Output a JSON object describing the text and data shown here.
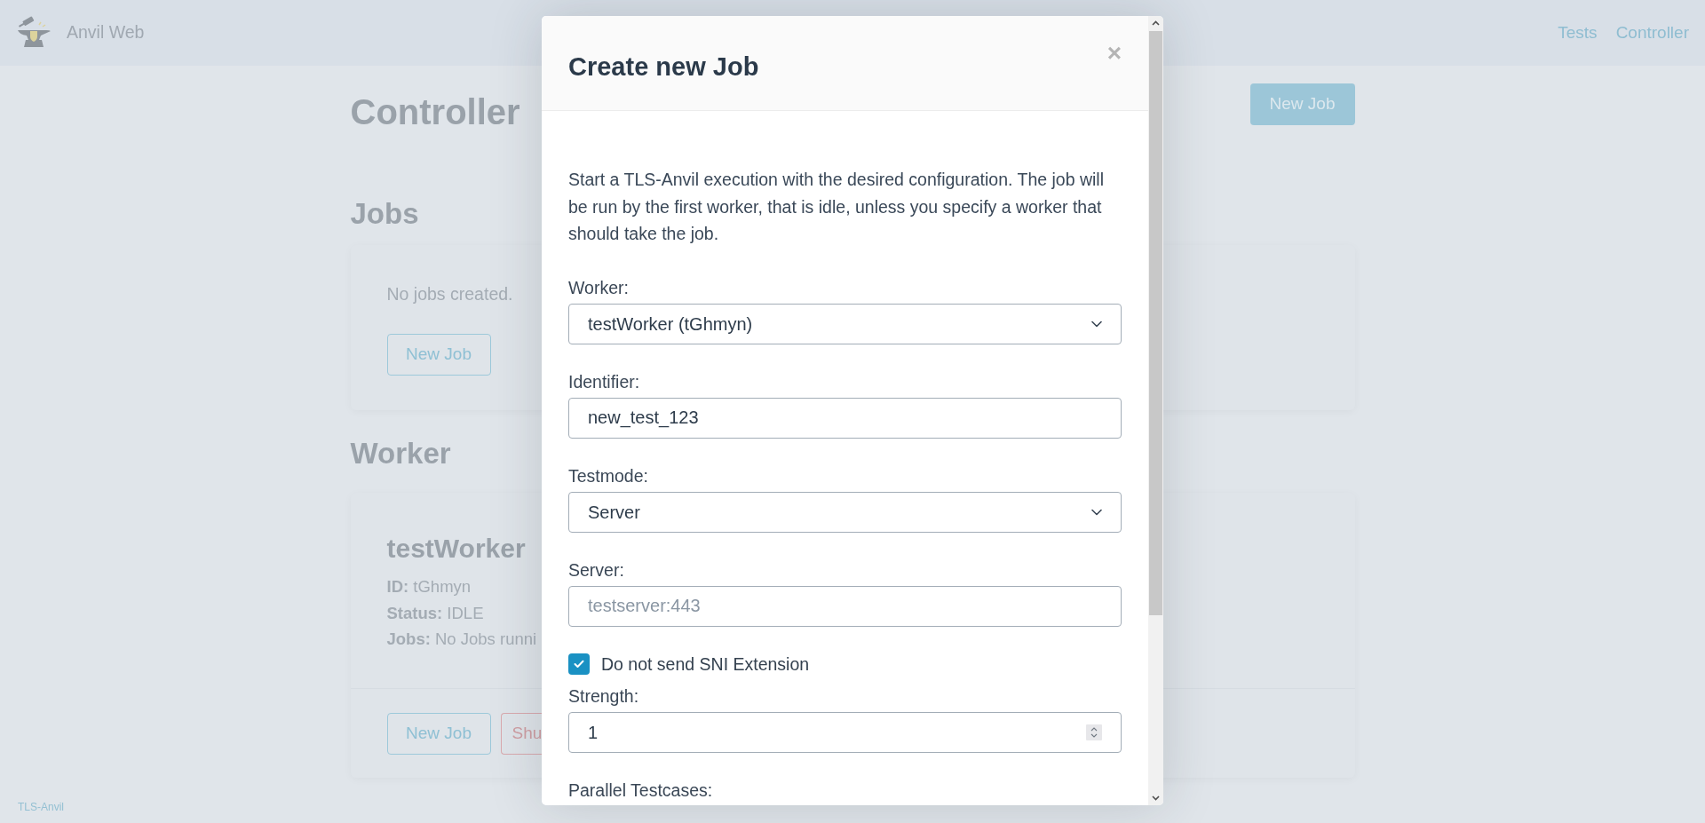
{
  "navbar": {
    "brand": "Anvil Web",
    "links": [
      {
        "label": "Tests"
      },
      {
        "label": "Controller"
      }
    ]
  },
  "page": {
    "title": "Controller",
    "new_job_button": "New Job",
    "jobs": {
      "heading": "Jobs",
      "empty_text": "No jobs created.",
      "button": "New Job"
    },
    "worker": {
      "heading": "Worker",
      "cards": [
        {
          "name": "testWorker",
          "lines": [
            "**ID:** tGhmyn",
            "**Status:** IDLE",
            "**Jobs:** No Jobs runni"
          ],
          "buttons": [
            {
              "label": "New Job",
              "kind": "primary"
            },
            {
              "label": "Shu",
              "kind": "danger"
            }
          ]
        }
      ]
    }
  },
  "footer": {
    "text": "TLS-Anvil"
  },
  "modal": {
    "title": "Create new Job",
    "close": "×",
    "description": "Start a TLS-Anvil execution with the desired configuration. The job will be run by the first worker, that is idle, unless you specify a worker that should take the job.",
    "fields": [
      {
        "kind": "select",
        "label": "Worker:",
        "value": "testWorker (tGhmyn)"
      },
      {
        "kind": "text",
        "label": "Identifier:",
        "value": "new_test_123"
      },
      {
        "kind": "select",
        "label": "Testmode:",
        "value": "Server"
      },
      {
        "kind": "text",
        "label": "Server:",
        "placeholder": "testserver:443"
      },
      {
        "kind": "checkbox",
        "label": "Do not send SNI Extension",
        "checked": true
      },
      {
        "kind": "number",
        "label": "Strength:",
        "value": "1"
      },
      {
        "kind": "label",
        "label": "Parallel Testcases:"
      }
    ]
  }
}
